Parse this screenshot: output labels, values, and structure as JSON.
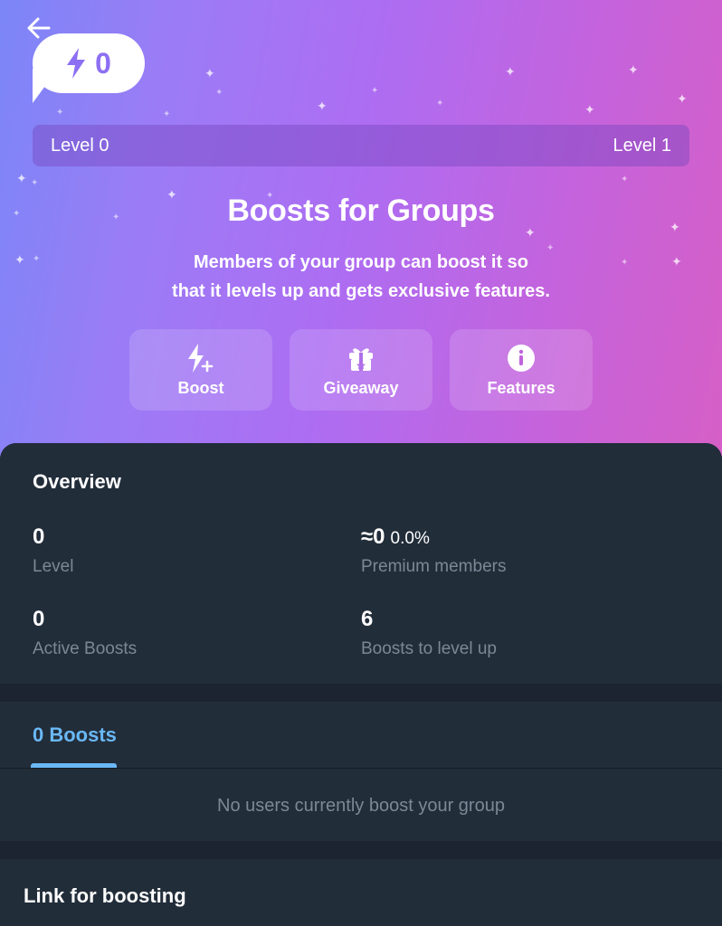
{
  "header": {
    "boost_count": "0",
    "level_current": "Level 0",
    "level_next": "Level 1"
  },
  "hero": {
    "title": "Boosts for Groups",
    "subtitle_line1": "Members of your group can boost it so",
    "subtitle_line2": "that it levels up and gets exclusive features."
  },
  "actions": [
    {
      "label": "Boost",
      "icon": "boost-icon"
    },
    {
      "label": "Giveaway",
      "icon": "gift-icon"
    },
    {
      "label": "Features",
      "icon": "info-icon"
    }
  ],
  "overview": {
    "title": "Overview",
    "level_value": "0",
    "level_label": "Level",
    "premium_value": "≈0",
    "premium_percent": "0.0%",
    "premium_label": "Premium members",
    "active_value": "0",
    "active_label": "Active Boosts",
    "to_level_value": "6",
    "to_level_label": "Boosts to level up"
  },
  "boosts_tab": {
    "label": "0 Boosts",
    "empty_message": "No users currently boost your group"
  },
  "link_section": {
    "title": "Link for boosting"
  },
  "colors": {
    "accent": "#6ab8f5",
    "panel": "#222d3a",
    "background": "#1b2430",
    "gradient_start": "#7b86f7",
    "gradient_end": "#d65fc6"
  }
}
